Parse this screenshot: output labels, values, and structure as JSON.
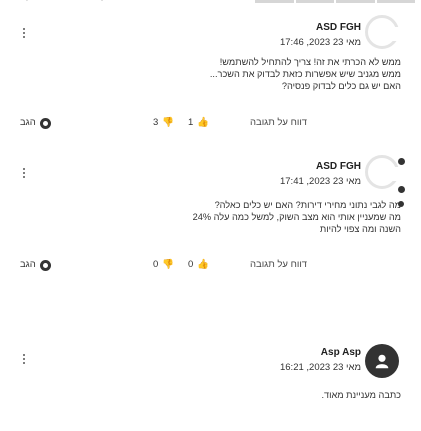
{
  "comments": [
    {
      "author": "ASD FGH",
      "time": "17:46 ,2023 מאי 23",
      "lines": [
        "ממש לא הכרתי את זה! צריך להתחיל להשתמש!",
        "ממש מגניב שיש אפשרות כזאת לבדוק את השכר...",
        "האם יש גם כלים לבדוק פנסיה?"
      ],
      "likes": "1",
      "dislikes": "3",
      "reply_label": "הגב",
      "report_label": "דווח על תגובה"
    },
    {
      "author": "ASD FGH",
      "time": "17:41 ,2023 מאי 23",
      "lines": [
        "מה לגבי נתוני מחירי דירות? האם יש כלים כאלה?",
        "מה שמעניין אותי הוא מצב השוק, למשל כמה עלה 24%",
        "השנה ומה צפוי להיות"
      ],
      "likes": "0",
      "dislikes": "0",
      "reply_label": "הגב",
      "report_label": "דווח על תגובה"
    },
    {
      "author": "Asp Asp",
      "time": "16:21 ,2023 מאי 23",
      "lines": [
        "כתבה מעניינת מאוד."
      ]
    }
  ]
}
